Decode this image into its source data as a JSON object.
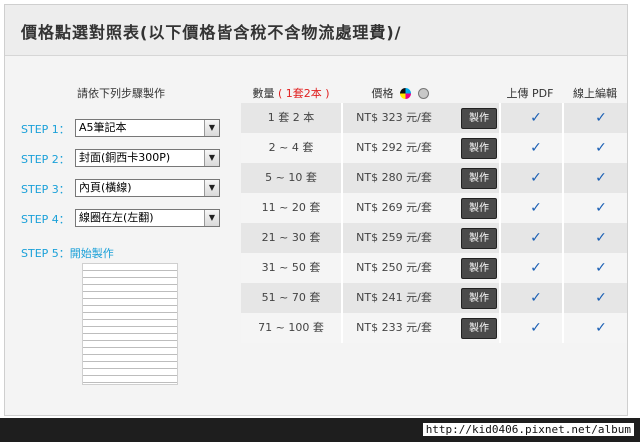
{
  "title": "價格點選對照表(以下價格皆含稅不含物流處理費)/",
  "steps_header": "請依下列步驟製作",
  "steps": [
    {
      "label": "STEP 1：",
      "value": "A5筆記本"
    },
    {
      "label": "STEP 2：",
      "value": "封面(銅西卡300P)"
    },
    {
      "label": "STEP 3：",
      "value": "內頁(橫線)"
    },
    {
      "label": "STEP 4：",
      "value": "線圈在左(左翻)"
    }
  ],
  "step5": {
    "label": "STEP 5：",
    "link": "開始製作"
  },
  "table": {
    "headers": {
      "qty": "數量",
      "qty_note": "( 1套2本 )",
      "price": "價格",
      "pdf": "上傳 PDF",
      "edit": "線上編輯"
    },
    "rows": [
      {
        "qty": "1 套 2 本",
        "price": "NT$ 323 元/套"
      },
      {
        "qty": "2 ~ 4 套",
        "price": "NT$ 292 元/套"
      },
      {
        "qty": "5 ~ 10 套",
        "price": "NT$ 280 元/套"
      },
      {
        "qty": "11 ~ 20 套",
        "price": "NT$ 269 元/套"
      },
      {
        "qty": "21 ~ 30 套",
        "price": "NT$ 259 元/套"
      },
      {
        "qty": "31 ~ 50 套",
        "price": "NT$ 250 元/套"
      },
      {
        "qty": "51 ~ 70 套",
        "price": "NT$ 241 元/套"
      },
      {
        "qty": "71 ~ 100 套",
        "price": "NT$ 233 元/套"
      }
    ],
    "make_label": "製作",
    "check_glyph": "✓"
  },
  "icons": {
    "color": "cmyk-color-icon",
    "mono": "grayscale-icon",
    "check": "checkmark-icon",
    "dropdown": "chevron-down-icon"
  },
  "colors": {
    "accent": "#1aa0d8",
    "red": "#e02020",
    "check": "#1a5fb4",
    "button": "#4a4a4a"
  },
  "watermark": "http://kid0406.pixnet.net/album"
}
